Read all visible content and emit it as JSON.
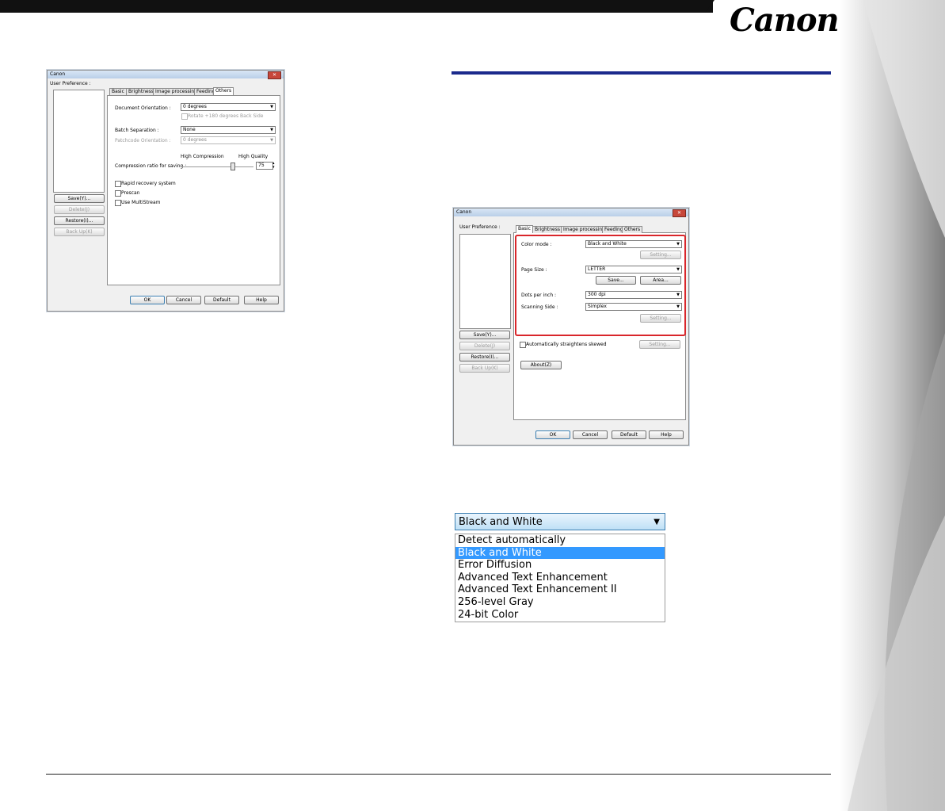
{
  "brand": {
    "logo_text": "Canon"
  },
  "dialog1": {
    "title": "Canon",
    "user_pref_label": "User Preference :",
    "tabs": [
      "Basic",
      "Brightness",
      "Image processing",
      "Feeding",
      "Others"
    ],
    "active_tab": "Others",
    "doc_orientation_label": "Document Orientation :",
    "doc_orientation_value": "0 degrees",
    "rotate_back_label": "Rotate +180 degrees Back Side",
    "batch_sep_label": "Batch Separation :",
    "batch_sep_value": "None",
    "patchcode_label": "Patchcode Orientation :",
    "patchcode_value": "0 degrees",
    "high_compression_label": "High Compression",
    "high_quality_label": "High Quality",
    "compression_label": "Compression ratio for saving :",
    "compression_value": "75",
    "rapid_recovery_label": "Rapid recovery system",
    "prescan_label": "Prescan",
    "multistream_label": "Use MultiStream",
    "save_btn": "Save(Y)...",
    "delete_btn": "Delete(J)",
    "restore_btn": "Restore(I)...",
    "backup_btn": "Back Up(K)",
    "ok_btn": "OK",
    "cancel_btn": "Cancel",
    "default_btn": "Default",
    "help_btn": "Help"
  },
  "dialog2": {
    "title": "Canon",
    "user_pref_label": "User Preference :",
    "tabs": [
      "Basic",
      "Brightness",
      "Image processing",
      "Feeding",
      "Others"
    ],
    "active_tab": "Basic",
    "color_mode_label": "Color mode :",
    "color_mode_value": "Black and White",
    "setting_btn": "Setting...",
    "page_size_label": "Page Size :",
    "page_size_value": "LETTER",
    "save_btn_small": "Save...",
    "area_btn": "Area...",
    "dpi_label": "Dots per inch :",
    "dpi_value": "300 dpi",
    "scanning_side_label": "Scanning Side :",
    "scanning_side_value": "Simplex",
    "setting_btn2": "Setting...",
    "straighten_label": "Automatically straightens skewed",
    "setting_btn3": "Setting...",
    "about_btn": "About(Z)",
    "save_btn": "Save(Y)...",
    "delete_btn": "Delete(J)",
    "restore_btn": "Restore(I)...",
    "backup_btn": "Back Up(K)",
    "ok_btn": "OK",
    "cancel_btn": "Cancel",
    "default_btn": "Default",
    "help_btn": "Help"
  },
  "dropdown": {
    "selected": "Black and White",
    "options": [
      "Detect automatically",
      "Black and White",
      "Error Diffusion",
      "Advanced Text Enhancement",
      "Advanced Text Enhancement II",
      "256-level Gray",
      "24-bit Color"
    ],
    "highlighted_index": 1
  },
  "colors": {
    "rule_blue": "#1b2a8c",
    "highlight": "#3399ff",
    "red_box": "#d9262b"
  }
}
